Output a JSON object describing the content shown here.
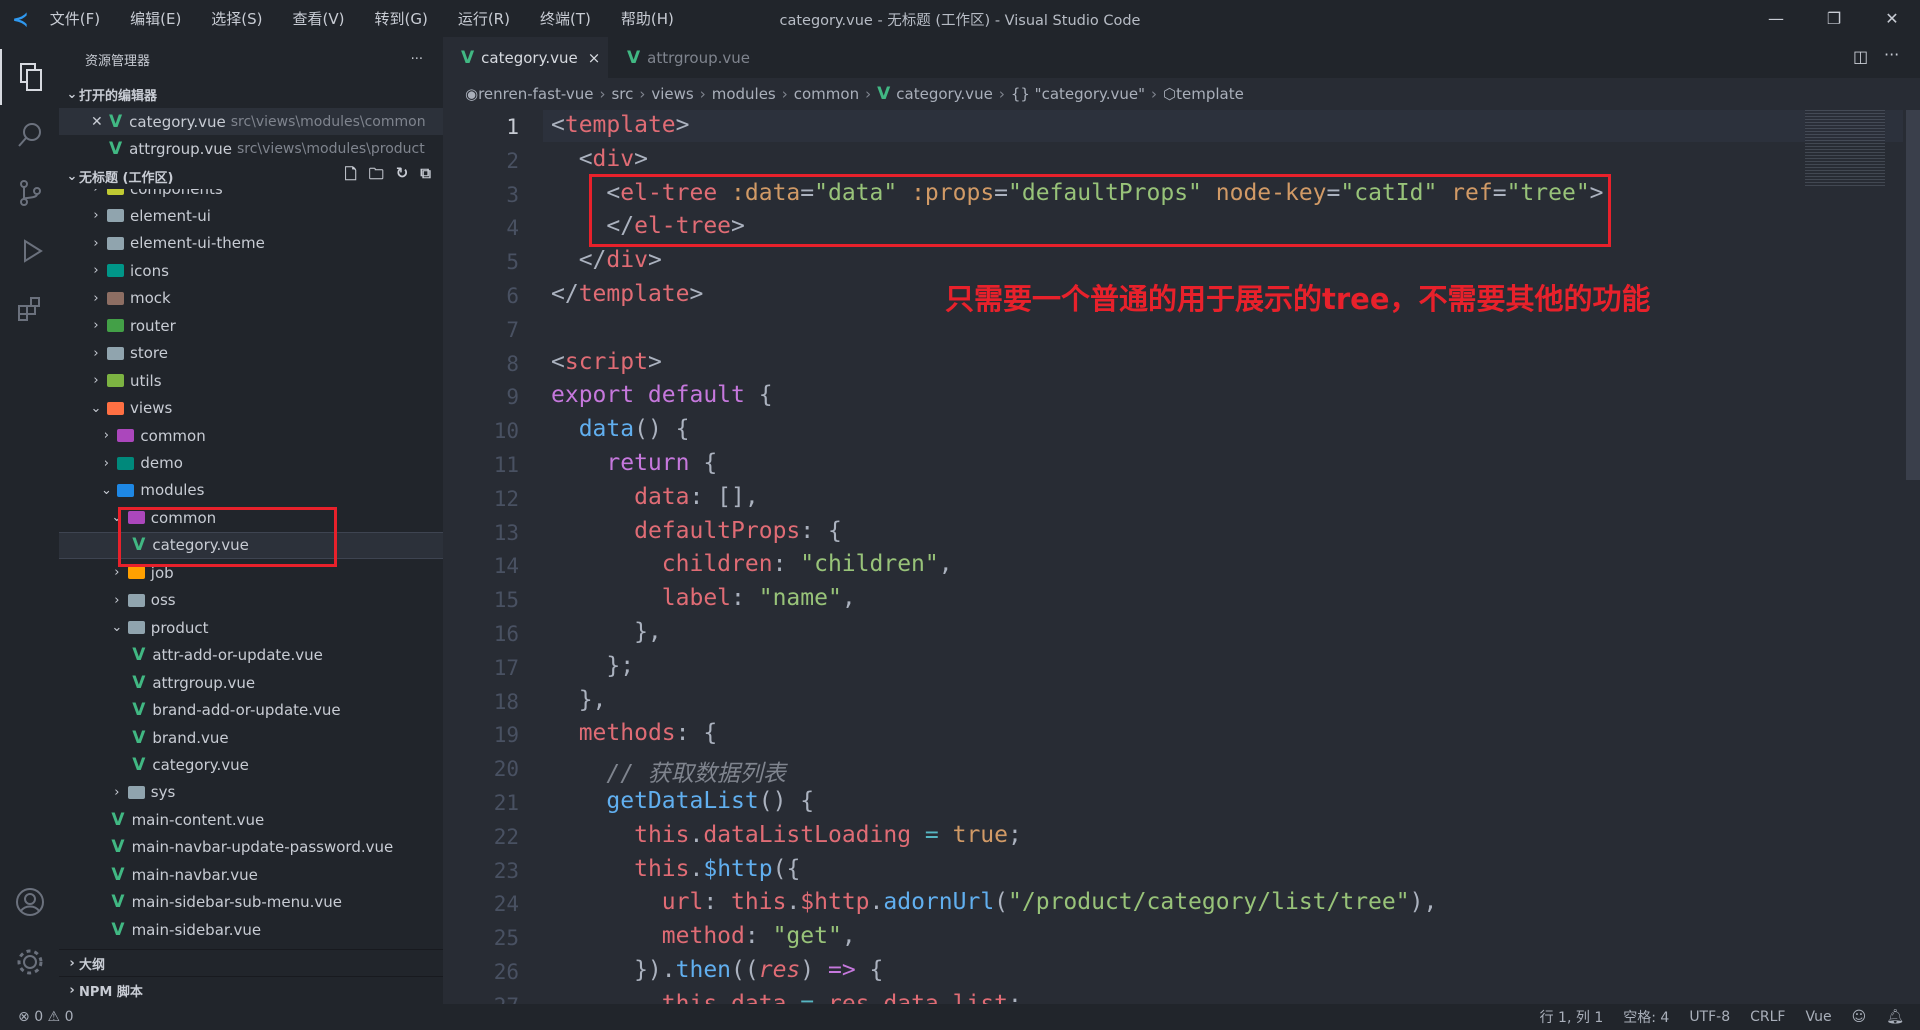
{
  "titlebar": {
    "menus": [
      "文件(F)",
      "编辑(E)",
      "选择(S)",
      "查看(V)",
      "转到(G)",
      "运行(R)",
      "终端(T)",
      "帮助(H)"
    ],
    "title": "category.vue - 无标题 (工作区) - Visual Studio Code"
  },
  "activity": {
    "items": [
      "files-icon",
      "search-icon",
      "source-control-icon",
      "run-debug-icon",
      "extensions-icon"
    ],
    "bottom": [
      "account-icon",
      "settings-gear-icon"
    ]
  },
  "sidebar": {
    "title": "资源管理器",
    "more": "···",
    "open_editors": {
      "label": "打开的编辑器",
      "items": [
        {
          "name": "category.vue",
          "path": "src\\views\\modules\\common",
          "active": true
        },
        {
          "name": "attrgroup.vue",
          "path": "src\\views\\modules\\product",
          "active": false
        }
      ]
    },
    "workspace": {
      "label": "无标题 (工作区)"
    },
    "tree": [
      {
        "name": "components",
        "level": 1,
        "kind": "folder",
        "open": false,
        "color": "#c0ca33"
      },
      {
        "name": "element-ui",
        "level": 1,
        "kind": "folder",
        "open": false,
        "color": "#90a4ae"
      },
      {
        "name": "element-ui-theme",
        "level": 1,
        "kind": "folder",
        "open": false,
        "color": "#90a4ae"
      },
      {
        "name": "icons",
        "level": 1,
        "kind": "folder",
        "open": false,
        "color": "#009688"
      },
      {
        "name": "mock",
        "level": 1,
        "kind": "folder",
        "open": false,
        "color": "#8d6e63"
      },
      {
        "name": "router",
        "level": 1,
        "kind": "folder",
        "open": false,
        "color": "#43a047"
      },
      {
        "name": "store",
        "level": 1,
        "kind": "folder",
        "open": false,
        "color": "#90a4ae"
      },
      {
        "name": "utils",
        "level": 1,
        "kind": "folder",
        "open": false,
        "color": "#7cb342"
      },
      {
        "name": "views",
        "level": 1,
        "kind": "folder",
        "open": true,
        "color": "#ff7043"
      },
      {
        "name": "common",
        "level": 2,
        "kind": "folder",
        "open": false,
        "color": "#ab47bc"
      },
      {
        "name": "demo",
        "level": 2,
        "kind": "folder",
        "open": false,
        "color": "#00897b"
      },
      {
        "name": "modules",
        "level": 2,
        "kind": "folder",
        "open": true,
        "color": "#1e88e5"
      },
      {
        "name": "common",
        "level": 3,
        "kind": "folder",
        "open": true,
        "color": "#ab47bc"
      },
      {
        "name": "category.vue",
        "level": 4,
        "kind": "vue",
        "selected": true
      },
      {
        "name": "job",
        "level": 3,
        "kind": "folder",
        "open": false,
        "color": "#ffa000"
      },
      {
        "name": "oss",
        "level": 3,
        "kind": "folder",
        "open": false,
        "color": "#90a4ae"
      },
      {
        "name": "product",
        "level": 3,
        "kind": "folder",
        "open": true,
        "color": "#90a4ae"
      },
      {
        "name": "attr-add-or-update.vue",
        "level": 4,
        "kind": "vue"
      },
      {
        "name": "attrgroup.vue",
        "level": 4,
        "kind": "vue"
      },
      {
        "name": "brand-add-or-update.vue",
        "level": 4,
        "kind": "vue"
      },
      {
        "name": "brand.vue",
        "level": 4,
        "kind": "vue"
      },
      {
        "name": "category.vue",
        "level": 4,
        "kind": "vue"
      },
      {
        "name": "sys",
        "level": 3,
        "kind": "folder",
        "open": false,
        "color": "#90a4ae"
      },
      {
        "name": "main-content.vue",
        "level": 2,
        "kind": "vue"
      },
      {
        "name": "main-navbar-update-password.vue",
        "level": 2,
        "kind": "vue"
      },
      {
        "name": "main-navbar.vue",
        "level": 2,
        "kind": "vue"
      },
      {
        "name": "main-sidebar-sub-menu.vue",
        "level": 2,
        "kind": "vue"
      },
      {
        "name": "main-sidebar.vue",
        "level": 2,
        "kind": "vue"
      }
    ],
    "outline": "大纲",
    "npm": "NPM 脚本"
  },
  "tabs": [
    {
      "name": "category.vue",
      "active": true,
      "close": "×"
    },
    {
      "name": "attrgroup.vue",
      "active": false
    }
  ],
  "breadcrumb": [
    "renren-fast-vue",
    "src",
    "views",
    "modules",
    "common",
    "category.vue",
    "{} \"category.vue\"",
    "template"
  ],
  "editor": {
    "annotation": "只需要一个普通的用于展示的tree，不需要其他的功能",
    "lines": [
      [
        [
          "<",
          "p"
        ],
        [
          "template",
          "t"
        ],
        [
          ">",
          "p"
        ]
      ],
      [
        [
          "  <",
          "p"
        ],
        [
          "div",
          "t"
        ],
        [
          ">",
          "p"
        ]
      ],
      [
        [
          "    <",
          "p"
        ],
        [
          "el-tree",
          "t"
        ],
        [
          " :data",
          "a"
        ],
        [
          "=",
          "p"
        ],
        [
          "\"data\"",
          "s"
        ],
        [
          " :props",
          "a"
        ],
        [
          "=",
          "p"
        ],
        [
          "\"defaultProps\"",
          "s"
        ],
        [
          " node-key",
          "a"
        ],
        [
          "=",
          "p"
        ],
        [
          "\"catId\"",
          "s"
        ],
        [
          " ref",
          "a"
        ],
        [
          "=",
          "p"
        ],
        [
          "\"tree\"",
          "s"
        ],
        [
          ">",
          "p"
        ]
      ],
      [
        [
          "    </",
          "p"
        ],
        [
          "el-tree",
          "t"
        ],
        [
          ">",
          "p"
        ]
      ],
      [
        [
          "  </",
          "p"
        ],
        [
          "div",
          "t"
        ],
        [
          ">",
          "p"
        ]
      ],
      [
        [
          "</",
          "p"
        ],
        [
          "template",
          "t"
        ],
        [
          ">",
          "p"
        ]
      ],
      [],
      [
        [
          "<",
          "p"
        ],
        [
          "script",
          "t"
        ],
        [
          ">",
          "p"
        ]
      ],
      [
        [
          "export default",
          "k"
        ],
        [
          " {",
          "p"
        ]
      ],
      [
        [
          "  ",
          "p"
        ],
        [
          "data",
          "f"
        ],
        [
          "() {",
          "p"
        ]
      ],
      [
        [
          "    ",
          "p"
        ],
        [
          "return",
          "k"
        ],
        [
          " {",
          "p"
        ]
      ],
      [
        [
          "      ",
          "p"
        ],
        [
          "data",
          "v"
        ],
        [
          ": [],",
          "p"
        ]
      ],
      [
        [
          "      ",
          "p"
        ],
        [
          "defaultProps",
          "v"
        ],
        [
          ": {",
          "p"
        ]
      ],
      [
        [
          "        ",
          "p"
        ],
        [
          "children",
          "v"
        ],
        [
          ": ",
          "p"
        ],
        [
          "\"children\"",
          "s"
        ],
        [
          ",",
          "p"
        ]
      ],
      [
        [
          "        ",
          "p"
        ],
        [
          "label",
          "v"
        ],
        [
          ": ",
          "p"
        ],
        [
          "\"name\"",
          "s"
        ],
        [
          ",",
          "p"
        ]
      ],
      [
        [
          "      },",
          "p"
        ]
      ],
      [
        [
          "    };",
          "p"
        ]
      ],
      [
        [
          "  },",
          "p"
        ]
      ],
      [
        [
          "  ",
          "p"
        ],
        [
          "methods",
          "v"
        ],
        [
          ": {",
          "p"
        ]
      ],
      [
        [
          "    // 获取数据列表",
          "c"
        ]
      ],
      [
        [
          "    ",
          "p"
        ],
        [
          "getDataList",
          "f"
        ],
        [
          "() {",
          "p"
        ]
      ],
      [
        [
          "      ",
          "p"
        ],
        [
          "this",
          "v"
        ],
        [
          ".",
          "p"
        ],
        [
          "dataListLoading",
          "v"
        ],
        [
          " = ",
          "o"
        ],
        [
          "true",
          "a"
        ],
        [
          ";",
          "p"
        ]
      ],
      [
        [
          "      ",
          "p"
        ],
        [
          "this",
          "v"
        ],
        [
          ".",
          "p"
        ],
        [
          "$http",
          "f"
        ],
        [
          "({",
          "p"
        ]
      ],
      [
        [
          "        ",
          "p"
        ],
        [
          "url",
          "v"
        ],
        [
          ": ",
          "p"
        ],
        [
          "this",
          "v"
        ],
        [
          ".",
          "p"
        ],
        [
          "$http",
          "v"
        ],
        [
          ".",
          "p"
        ],
        [
          "adornUrl",
          "f"
        ],
        [
          "(",
          "p"
        ],
        [
          "\"/product/category/list/tree\"",
          "s"
        ],
        [
          "),",
          "p"
        ]
      ],
      [
        [
          "        ",
          "p"
        ],
        [
          "method",
          "v"
        ],
        [
          ": ",
          "p"
        ],
        [
          "\"get\"",
          "s"
        ],
        [
          ",",
          "p"
        ]
      ],
      [
        [
          "      }).",
          "p"
        ],
        [
          "then",
          "f"
        ],
        [
          "((",
          "p"
        ],
        [
          "res",
          "pi"
        ],
        [
          ") ",
          "p"
        ],
        [
          "=>",
          "k"
        ],
        [
          " {",
          "p"
        ]
      ],
      [
        [
          "        ",
          "p"
        ],
        [
          "this",
          "v"
        ],
        [
          ".",
          "p"
        ],
        [
          "data",
          "v"
        ],
        [
          " = ",
          "o"
        ],
        [
          "res",
          "v"
        ],
        [
          ".",
          "p"
        ],
        [
          "data",
          "v"
        ],
        [
          ".",
          "p"
        ],
        [
          "list",
          "v"
        ],
        [
          ";",
          "p"
        ]
      ]
    ]
  },
  "statusbar": {
    "errors": "0",
    "warnings": "0",
    "position": "行 1, 列 1",
    "spaces": "空格: 4",
    "encoding": "UTF-8",
    "eol": "CRLF",
    "language": "Vue"
  }
}
